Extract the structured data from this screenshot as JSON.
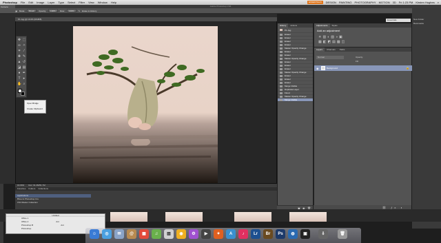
{
  "menubar": {
    "app": "Photoshop",
    "items": [
      "File",
      "Edit",
      "Image",
      "Layer",
      "Type",
      "Select",
      "Filter",
      "View",
      "Window",
      "Help"
    ],
    "workspaces": [
      "ESSENTIALS",
      "DESIGN",
      "PAINTING",
      "PHOTOGRAPHY",
      "MOTION",
      "3D"
    ],
    "clock": "Fri 1:23 PM",
    "user": "Kirsten Hughes"
  },
  "app_title": "Adobe Photoshop CS6",
  "options_bar": {
    "items": [
      "Mode:",
      "Brush",
      "Opacity:",
      "100%",
      "Flow:",
      "100%",
      "Erase to History"
    ],
    "side_label": "Camera"
  },
  "document": {
    "tab": "P1.Jpg @ 16.6% (RGB/8)",
    "status_zoom": "16.66%",
    "status_doc": "Doc: 61.4M/51.7M"
  },
  "context_menu": {
    "items": [
      "Open Bridge",
      "Create Clipboard"
    ]
  },
  "history": {
    "tabs": [
      "History",
      "Actions"
    ],
    "snapshot": "P1.Jpg",
    "rows": [
      "Eraser",
      "Eraser",
      "Eraser",
      "Eraser",
      "Master Opacity Change",
      "Eraser",
      "Eraser",
      "Master Opacity Change",
      "Eraser",
      "Eraser",
      "Eraser",
      "Master Opacity Change",
      "Eraser",
      "Eraser",
      "Eraser",
      "Merge Visible",
      "Duplicate Layer",
      "Flood",
      "Master Opacity Change",
      "Merge Visible"
    ]
  },
  "adjustments": {
    "tabs": [
      "Adjustments",
      "Styles"
    ],
    "title": "Add an adjustment"
  },
  "layers": {
    "tabs": [
      "Layers",
      "Channels",
      "Paths"
    ],
    "blend": "Normal",
    "opacity_label": "Opacity:",
    "fill_label": "Fill:",
    "layer_name": "Background"
  },
  "right": {
    "search": "Essentials",
    "items": [
      "New Folder",
      "Bookmarks"
    ]
  },
  "bridge": {
    "tabs": [
      "Favorites",
      "Folders",
      "Collections"
    ],
    "folders": [
      "Applications",
      "Bhoomi Photoshop Cre",
      "CS4 Master Collection"
    ]
  },
  "small_window": {
    "title": "Untitled",
    "rows": [
      [
        "Office 1",
        ""
      ],
      [
        "Office 2",
        "Ant"
      ],
      [
        "Photoshop B",
        "Ant"
      ],
      [
        "Photoshop",
        ""
      ]
    ]
  },
  "dock_apps": [
    "Finder",
    "Safari",
    "Mail",
    "Contacts",
    "Calendar",
    "iTunes",
    "Preview",
    "Chrome",
    "Lightroom",
    "Bridge",
    "Photoshop",
    "System",
    "Trash"
  ],
  "colors": {
    "selection": "#8896b8",
    "panel": "#535353",
    "workspace_accent": "#e07820"
  }
}
